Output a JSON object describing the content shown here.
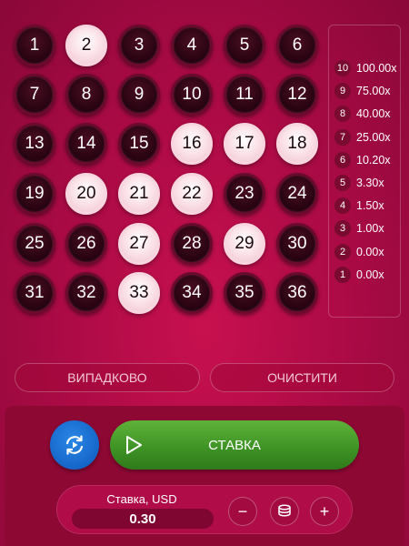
{
  "board": {
    "numbers": [
      {
        "n": "1",
        "selected": false
      },
      {
        "n": "2",
        "selected": true
      },
      {
        "n": "3",
        "selected": false
      },
      {
        "n": "4",
        "selected": false
      },
      {
        "n": "5",
        "selected": false
      },
      {
        "n": "6",
        "selected": false
      },
      {
        "n": "7",
        "selected": false
      },
      {
        "n": "8",
        "selected": false
      },
      {
        "n": "9",
        "selected": false
      },
      {
        "n": "10",
        "selected": false
      },
      {
        "n": "11",
        "selected": false
      },
      {
        "n": "12",
        "selected": false
      },
      {
        "n": "13",
        "selected": false
      },
      {
        "n": "14",
        "selected": false
      },
      {
        "n": "15",
        "selected": false
      },
      {
        "n": "16",
        "selected": true
      },
      {
        "n": "17",
        "selected": true
      },
      {
        "n": "18",
        "selected": true
      },
      {
        "n": "19",
        "selected": false
      },
      {
        "n": "20",
        "selected": true
      },
      {
        "n": "21",
        "selected": true
      },
      {
        "n": "22",
        "selected": true
      },
      {
        "n": "23",
        "selected": false
      },
      {
        "n": "24",
        "selected": false
      },
      {
        "n": "25",
        "selected": false
      },
      {
        "n": "26",
        "selected": false
      },
      {
        "n": "27",
        "selected": true
      },
      {
        "n": "28",
        "selected": false
      },
      {
        "n": "29",
        "selected": true
      },
      {
        "n": "30",
        "selected": false
      },
      {
        "n": "31",
        "selected": false
      },
      {
        "n": "32",
        "selected": false
      },
      {
        "n": "33",
        "selected": true
      },
      {
        "n": "34",
        "selected": false
      },
      {
        "n": "35",
        "selected": false
      },
      {
        "n": "36",
        "selected": false
      }
    ]
  },
  "paytable": [
    {
      "count": "10",
      "multiplier": "100.00x"
    },
    {
      "count": "9",
      "multiplier": "75.00x"
    },
    {
      "count": "8",
      "multiplier": "40.00x"
    },
    {
      "count": "7",
      "multiplier": "25.00x"
    },
    {
      "count": "6",
      "multiplier": "10.20x"
    },
    {
      "count": "5",
      "multiplier": "3.30x"
    },
    {
      "count": "4",
      "multiplier": "1.50x"
    },
    {
      "count": "3",
      "multiplier": "1.00x"
    },
    {
      "count": "2",
      "multiplier": "0.00x"
    },
    {
      "count": "1",
      "multiplier": "0.00x"
    }
  ],
  "actions": {
    "random_label": "ВИПАДКОВО",
    "clear_label": "ОЧИСТИТИ"
  },
  "controls": {
    "autoplay_icon": "autoplay-icon",
    "bet_label": "СТАВКА",
    "play_icon": "play-icon"
  },
  "stake": {
    "label": "Ставка, USD",
    "value": "0.30",
    "minus_label": "−",
    "plus_label": "+",
    "chips_icon": "coin-stack-icon"
  },
  "colors": {
    "background": "#b50c4a",
    "selected_ball": "#f6d3dd",
    "unselected_ball": "#2a0412",
    "bet_button": "#43992a",
    "autoplay_button": "#1a6fd6"
  }
}
